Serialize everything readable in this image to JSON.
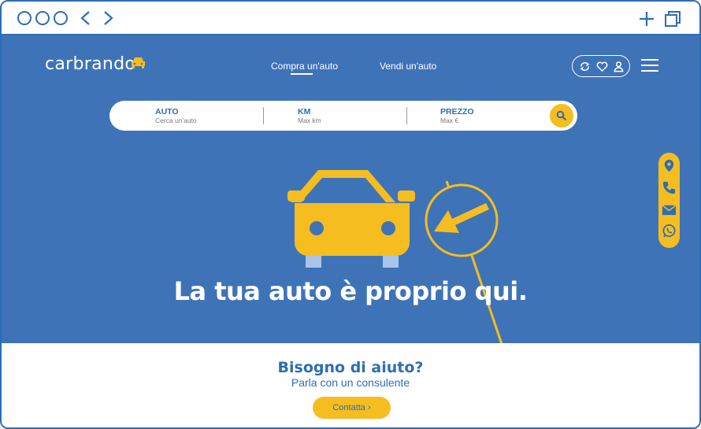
{
  "header": {
    "logo_text": "carbrando",
    "nav": [
      {
        "label": "Compra un'auto",
        "active": true
      },
      {
        "label": "Vendi un'auto",
        "active": false
      }
    ]
  },
  "search": {
    "fields": [
      {
        "label": "AUTO",
        "placeholder": "Cerca un'auto"
      },
      {
        "label": "KM",
        "placeholder": "Max km"
      },
      {
        "label": "PREZZO",
        "placeholder": "Max €"
      }
    ]
  },
  "hero": {
    "headline": "La tua auto è proprio qui."
  },
  "help": {
    "title": "Bisogno di aiuto?",
    "subtitle": "Parla con un consulente",
    "cta_label": "Contatta ›"
  },
  "colors": {
    "primary_blue": "#3f73b8",
    "accent_yellow": "#f5bd1f",
    "text_blue": "#2d6db5"
  },
  "icons": [
    "add-tab-icon",
    "window-icon",
    "location-icon",
    "phone-icon",
    "mail-icon",
    "whatsapp-icon",
    "compare-icon",
    "heart-icon",
    "user-icon",
    "menu-icon",
    "search-icon"
  ]
}
